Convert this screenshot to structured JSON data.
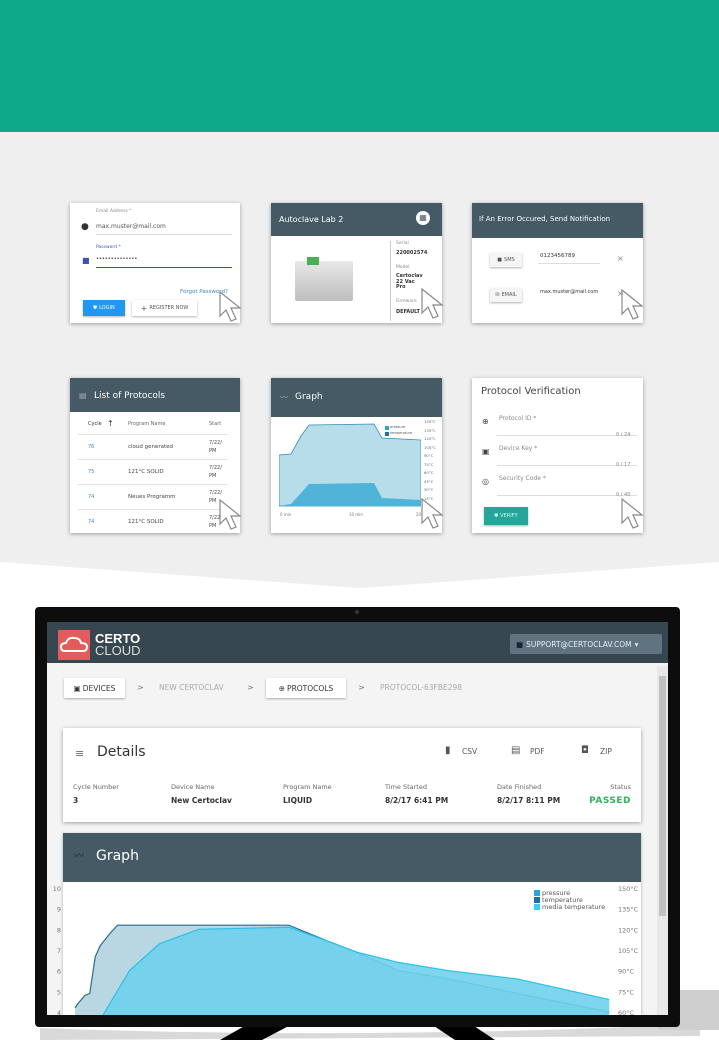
{
  "colors": {
    "brand_teal": "#0ea98a",
    "header_dark": "#455a64",
    "app_header": "#37474f",
    "logo_red": "#e35b5b",
    "link_blue": "#3a86c8",
    "passed_green": "#2db35d",
    "verify_teal": "#26a69a"
  },
  "login_card": {
    "email_label": "Email Address *",
    "email_value": "max.muster@mail.com",
    "password_label": "Password *",
    "password_value": "••••••••••••••",
    "forgot": "Forgot Password?",
    "login": "LOGIN",
    "register": "REGISTER NOW"
  },
  "device_card": {
    "title": "Autoclave Lab 2",
    "serial_label": "Serial",
    "serial": "220002574",
    "model_label": "Model",
    "model": "Certoclav 22 Vac Pro",
    "firmware_label": "Firmware",
    "firmware": "DEFAULT"
  },
  "notify_card": {
    "title": "If An Error Occured, Send Notification",
    "sms": "SMS",
    "sms_value": "0123456789",
    "email": "EMAIL",
    "email_value": "max.muster@mail.com",
    "remove": "×"
  },
  "protocols_card": {
    "title": "List of Protocols",
    "headers": [
      "Cycle",
      "Program Name",
      "Start"
    ],
    "sort_icon": "↑",
    "rows": [
      {
        "cycle": "76",
        "name": "cloud generated",
        "start": "7/22/",
        "ampm": "PM"
      },
      {
        "cycle": "75",
        "name": "121°C SOLID",
        "start": "7/22/",
        "ampm": "PM"
      },
      {
        "cycle": "74",
        "name": "Neues Programm",
        "start": "7/22/",
        "ampm": "PM"
      },
      {
        "cycle": "74",
        "name": "121°C SOLID",
        "start": "7/22/",
        "ampm": "PM"
      }
    ]
  },
  "graph_card": {
    "title": "Graph",
    "legend": [
      "pressure",
      "temperature"
    ],
    "y_ticks": [
      "150°C",
      "135°C",
      "120°C",
      "105°C",
      "90°C",
      "75°C",
      "60°C",
      "45°C",
      "30°C",
      "15°C"
    ],
    "x_ticks": [
      "0 min",
      "10 min",
      "20"
    ]
  },
  "verify_card": {
    "title": "Protocol Verification",
    "fields": [
      {
        "label": "Protocol ID *",
        "count": "0 / 24"
      },
      {
        "label": "Device Key *",
        "count": "0 / 17"
      },
      {
        "label": "Security Code *",
        "count": "0 / 40"
      }
    ],
    "verify": "VERIFY"
  },
  "app": {
    "logo_line1": "CERTO",
    "logo_line2": "CLOUD",
    "user": "SUPPORT@CERTOCLAV.COM",
    "breadcrumb": [
      "DEVICES",
      "NEW CERTOCLAV",
      "PROTOCOLS",
      "PROTOCOL-63FBE298"
    ],
    "sep": ">",
    "details": {
      "title": "Details",
      "csv": "CSV",
      "pdf": "PDF",
      "zip": "ZIP",
      "columns": [
        {
          "label": "Cycle Number",
          "value": "3"
        },
        {
          "label": "Device Name",
          "value": "New Certoclav"
        },
        {
          "label": "Program Name",
          "value": "LIQUID"
        },
        {
          "label": "Time Started",
          "value": "8/2/17 6:41 PM"
        },
        {
          "label": "Date Finished",
          "value": "8/2/17 8:11 PM"
        },
        {
          "label": "Status",
          "value": "PASSED"
        }
      ]
    },
    "graph_title": "Graph"
  },
  "chart_data": {
    "type": "area",
    "title": "Graph",
    "legend": [
      "pressure",
      "temperature",
      "media temperature"
    ],
    "legend_position": "top-right",
    "left_ticks": [
      "10",
      "9",
      "8",
      "7",
      "6",
      "5",
      "4"
    ],
    "right_ticks": [
      "150°C",
      "135°C",
      "120°C",
      "105°C",
      "90°C",
      "75°C",
      "60°C"
    ],
    "ylim_left": [
      4,
      10
    ],
    "ylim_right": [
      60,
      150
    ],
    "x": [
      0,
      1.3,
      1.8,
      3.1,
      4,
      5,
      5.9,
      7.7,
      9.1,
      11.3,
      16.8,
      24,
      40.6,
      48,
      53,
      60.7,
      70,
      82.6,
      99.5
    ],
    "series": [
      {
        "name": "temperature",
        "values": [
          null,
          63,
          66,
          72,
          73.5,
          100,
          108,
          117,
          123,
          123,
          123,
          123,
          123,
          111,
          103.5,
          90,
          84,
          73.5,
          60
        ]
      },
      {
        "name": "media temperature",
        "values": [
          null,
          null,
          null,
          null,
          null,
          null,
          54,
          null,
          null,
          90,
          109.5,
          120,
          121.5,
          111,
          103.5,
          96,
          90,
          84,
          69
        ]
      }
    ]
  }
}
